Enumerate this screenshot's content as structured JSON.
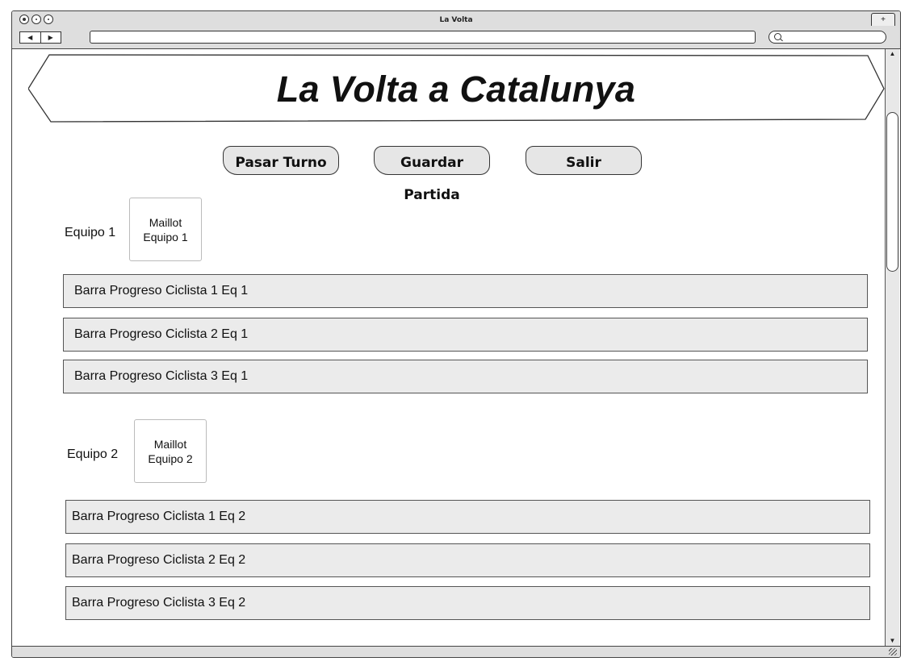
{
  "window": {
    "title": "La Volta",
    "new_tab_label": "+",
    "back_label": "◀",
    "forward_label": "▶"
  },
  "header": {
    "title": "La Volta a Catalunya"
  },
  "toolbar": {
    "pass_turn_label": "Pasar Turno",
    "save_game_label": "Guardar Partida",
    "exit_label": "Salir"
  },
  "teams": [
    {
      "label": "Equipo 1",
      "jersey_line1": "Maillot",
      "jersey_line2": "Equipo 1",
      "bars": [
        "Barra Progreso Ciclista 1 Eq 1",
        "Barra Progreso Ciclista 2 Eq 1",
        "Barra Progreso Ciclista 3 Eq 1"
      ]
    },
    {
      "label": "Equipo 2",
      "jersey_line1": "Maillot",
      "jersey_line2": "Equipo 2",
      "bars": [
        "Barra Progreso Ciclista 1 Eq 2",
        "Barra Progreso Ciclista 2 Eq 2",
        "Barra Progreso Ciclista 3 Eq 2"
      ]
    }
  ],
  "scrollbar": {
    "up_label": "▲",
    "down_label": "▼"
  }
}
